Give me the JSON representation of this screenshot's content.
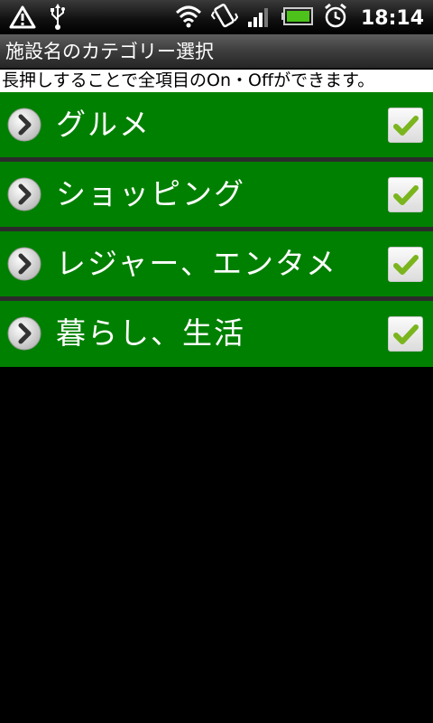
{
  "status_bar": {
    "time": "18:14",
    "icons": [
      "alert-icon",
      "usb-icon",
      "wifi-icon",
      "vibrate-icon",
      "signal-icon",
      "battery-icon",
      "alarm-icon"
    ]
  },
  "title": "施設名のカテゴリー選択",
  "instruction": "長押しすることで全項目のOn・Offができます。",
  "categories": [
    {
      "label": "グルメ",
      "checked": true
    },
    {
      "label": "ショッピング",
      "checked": true
    },
    {
      "label": "レジャー、エンタメ",
      "checked": true
    },
    {
      "label": "暮らし、生活",
      "checked": true
    }
  ],
  "colors": {
    "list_bg": "#008000",
    "check": "#7ab51d"
  }
}
